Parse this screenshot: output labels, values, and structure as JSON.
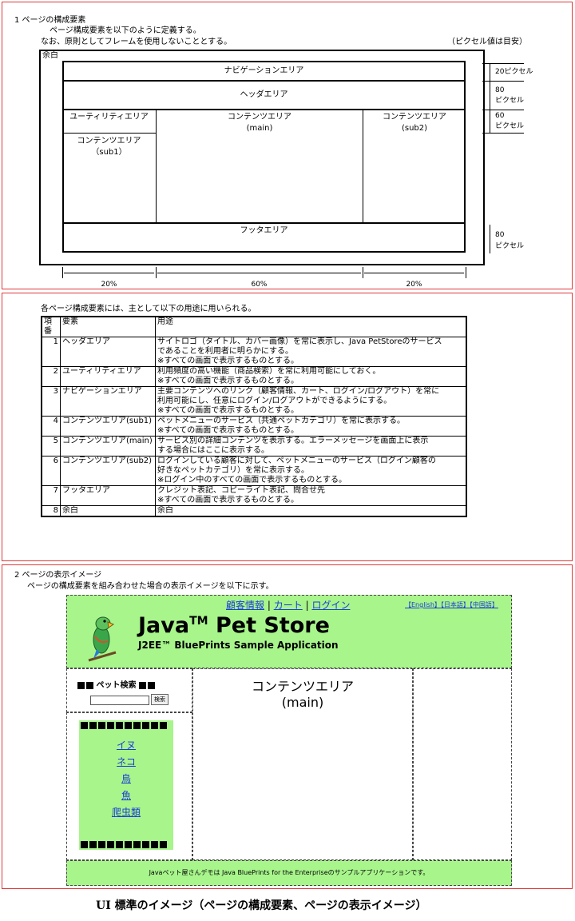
{
  "section1": {
    "heading": "1 ページの構成要素",
    "line1": "ページ構成要素を以下のように定義する。",
    "line2": "なお、原則としてフレームを使用しないこととする。",
    "note": "（ピクセル値は目安）",
    "margin_label": "余白",
    "nav_area": "ナビゲーションエリア",
    "header_area": "ヘッダエリア",
    "utility_area": "ユーティリティエリア",
    "contents_main": "コンテンツエリア",
    "contents_main_sub": "(main)",
    "contents_sub2": "コンテンツエリア",
    "contents_sub2_sub": "(sub2)",
    "contents_sub1": "コンテンツエリア",
    "contents_sub1_sub": "（sub1）",
    "footer_area": "フッタエリア",
    "dim_20px": "20ピクセル",
    "dim_80": "80",
    "dim_80_unit": "ピクセル",
    "dim_60": "60",
    "dim_60_unit": "ピクセル",
    "dim_footer_80": "80",
    "dim_footer_unit": "ピクセル",
    "width_left": "20%",
    "width_center": "60%",
    "width_right": "20%"
  },
  "table_section": {
    "intro": "各ページ構成要素には、主として以下の用途に用いられる。",
    "headers": [
      "項番",
      "要素",
      "用途"
    ],
    "rows": [
      {
        "no": "1",
        "element": "ヘッダエリア",
        "lines": [
          "サイトロゴ（タイトル、カバー画像）を常に表示し、Java PetStoreのサービス",
          "であることを利用者に明らかにする。",
          "※すべての画面で表示するものとする。"
        ]
      },
      {
        "no": "2",
        "element": "ユーティリティエリア",
        "lines": [
          "利用頻度の高い機能（商品検索）を常に利用可能にしておく。",
          "※すべての画面で表示するものとする。"
        ]
      },
      {
        "no": "3",
        "element": "ナビゲーションエリア",
        "lines": [
          "主要コンテンツへのリンク（顧客情報、カート、ログイン/ログアウト）を常に",
          "利用可能にし、任意にログイン/ログアウトができるようにする。",
          "※すべての画面で表示するものとする。"
        ]
      },
      {
        "no": "4",
        "element": "コンテンツエリア(sub1)",
        "lines": [
          "ペットメニューのサービス（共通ペットカテゴリ）を常に表示する。",
          "※すべての画面で表示するものとする。"
        ]
      },
      {
        "no": "5",
        "element": "コンテンツエリア(main)",
        "lines": [
          "サービス別の詳細コンテンツを表示する。エラーメッセージを画面上に表示",
          "する場合にはここに表示する。"
        ]
      },
      {
        "no": "6",
        "element": "コンテンツエリア(sub2)",
        "lines": [
          "ログインしている顧客に対して、ペットメニューのサービス（ログイン顧客の",
          "好きなペットカテゴリ）を常に表示する。",
          "※ログイン中のすべての画面で表示するものとする。"
        ]
      },
      {
        "no": "7",
        "element": "フッタエリア",
        "lines": [
          "クレジット表記、コピーライト表記、問合せ先",
          "※すべての画面で表示するものとする。"
        ]
      },
      {
        "no": "8",
        "element": "余白",
        "lines": [
          "余白"
        ]
      }
    ]
  },
  "section2": {
    "heading": "2 ページの表示イメージ",
    "line1": "ページの構成要素を組み合わせた場合の表示イメージを以下に示す。",
    "nav_links": [
      "顧客情報",
      "カート",
      "ログイン"
    ],
    "nav_sep": "|",
    "lang_links": [
      "【English】",
      "【日本語】",
      "【中国語】"
    ],
    "title": "Java",
    "title_tm": "TM",
    "title_rest": " Pet Store",
    "subtitle": "J2EE™ BluePrints Sample Application",
    "search_title": "ペット検索",
    "search_button": "検索",
    "search_value": "",
    "pets": [
      "イヌ",
      "ネコ",
      "鳥",
      "魚",
      "爬虫類"
    ],
    "main_label": "コンテンツエリア",
    "main_sub": "(main)",
    "footer_text": "Javaペット屋さんデモは Java BluePrints for the Enterpriseのサンプルアプリケーションです。",
    "colors": {
      "green": "#a8f58c",
      "link": "#1b3dd6",
      "frame": "#e03a3a"
    }
  },
  "caption": "UI 標準のイメージ（ページの構成要素、ページの表示イメージ）"
}
